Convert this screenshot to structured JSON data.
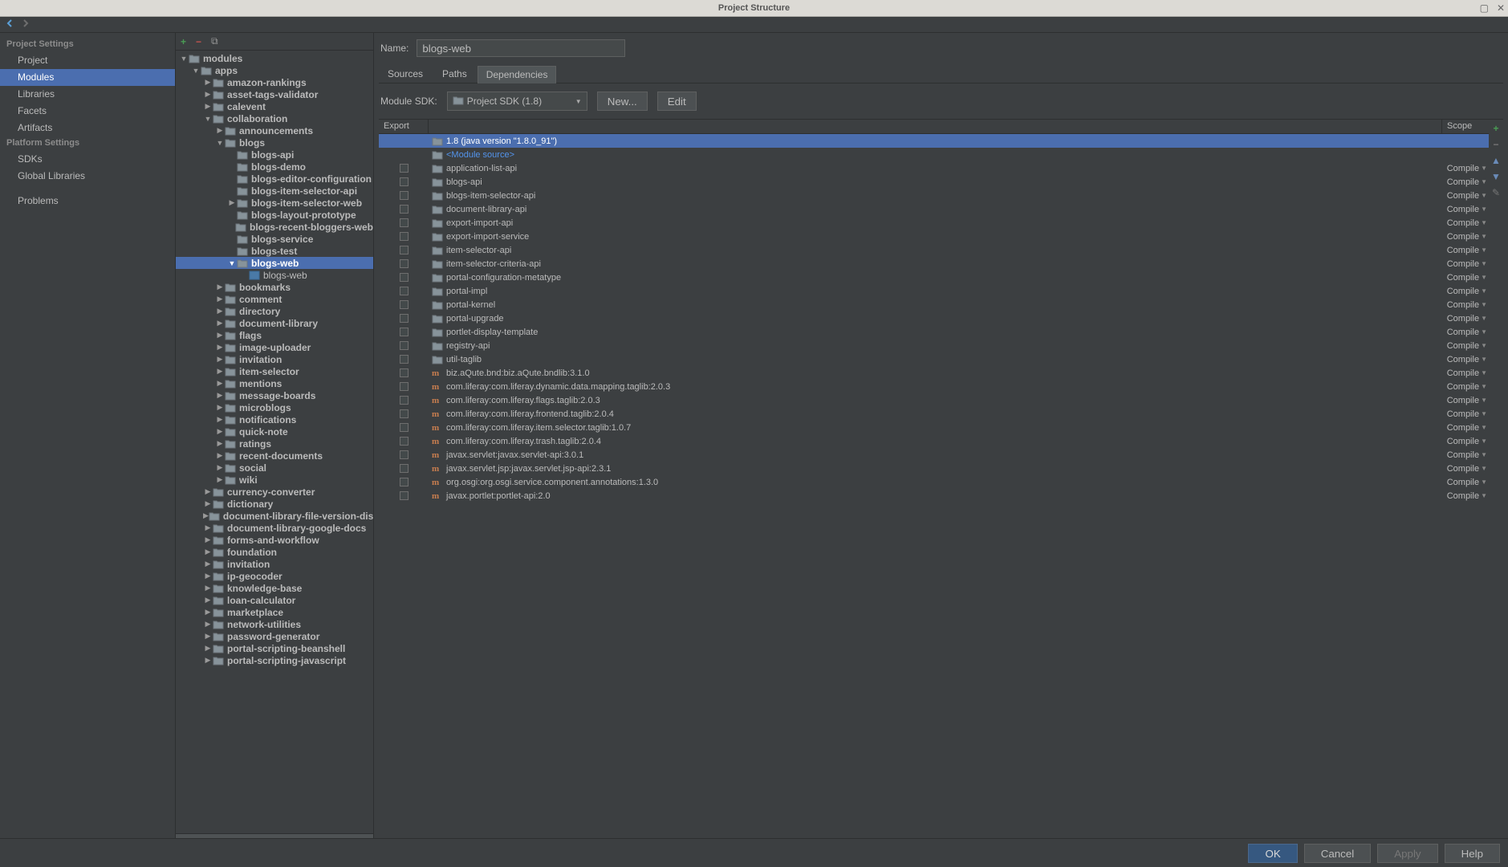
{
  "window_title": "Project Structure",
  "sidebar": {
    "section1": "Project Settings",
    "items1": [
      "Project",
      "Modules",
      "Libraries",
      "Facets",
      "Artifacts"
    ],
    "section2": "Platform Settings",
    "items2": [
      "SDKs",
      "Global Libraries"
    ],
    "problems": "Problems"
  },
  "tree": [
    {
      "d": 0,
      "arrow": "down",
      "icon": "root",
      "label": "modules"
    },
    {
      "d": 1,
      "arrow": "down",
      "icon": "folder",
      "label": "apps"
    },
    {
      "d": 2,
      "arrow": "right",
      "icon": "folder",
      "label": "amazon-rankings"
    },
    {
      "d": 2,
      "arrow": "right",
      "icon": "folder",
      "label": "asset-tags-validator"
    },
    {
      "d": 2,
      "arrow": "right",
      "icon": "folder",
      "label": "calevent"
    },
    {
      "d": 2,
      "arrow": "down",
      "icon": "folder",
      "label": "collaboration"
    },
    {
      "d": 3,
      "arrow": "right",
      "icon": "folder",
      "label": "announcements"
    },
    {
      "d": 3,
      "arrow": "down",
      "icon": "folder",
      "label": "blogs"
    },
    {
      "d": 4,
      "arrow": "",
      "icon": "folder",
      "label": "blogs-api"
    },
    {
      "d": 4,
      "arrow": "",
      "icon": "folder",
      "label": "blogs-demo"
    },
    {
      "d": 4,
      "arrow": "",
      "icon": "folder",
      "label": "blogs-editor-configuration"
    },
    {
      "d": 4,
      "arrow": "",
      "icon": "folder",
      "label": "blogs-item-selector-api"
    },
    {
      "d": 4,
      "arrow": "right",
      "icon": "folder",
      "label": "blogs-item-selector-web"
    },
    {
      "d": 4,
      "arrow": "",
      "icon": "folder",
      "label": "blogs-layout-prototype"
    },
    {
      "d": 4,
      "arrow": "",
      "icon": "folder",
      "label": "blogs-recent-bloggers-web"
    },
    {
      "d": 4,
      "arrow": "",
      "icon": "folder",
      "label": "blogs-service"
    },
    {
      "d": 4,
      "arrow": "",
      "icon": "folder",
      "label": "blogs-test"
    },
    {
      "d": 4,
      "arrow": "down",
      "icon": "folder",
      "label": "blogs-web",
      "sel": true
    },
    {
      "d": 5,
      "arrow": "",
      "icon": "mod",
      "label": "blogs-web",
      "norm": true
    },
    {
      "d": 3,
      "arrow": "right",
      "icon": "folder",
      "label": "bookmarks"
    },
    {
      "d": 3,
      "arrow": "right",
      "icon": "folder",
      "label": "comment"
    },
    {
      "d": 3,
      "arrow": "right",
      "icon": "folder",
      "label": "directory"
    },
    {
      "d": 3,
      "arrow": "right",
      "icon": "folder",
      "label": "document-library"
    },
    {
      "d": 3,
      "arrow": "right",
      "icon": "folder",
      "label": "flags"
    },
    {
      "d": 3,
      "arrow": "right",
      "icon": "folder",
      "label": "image-uploader"
    },
    {
      "d": 3,
      "arrow": "right",
      "icon": "folder",
      "label": "invitation"
    },
    {
      "d": 3,
      "arrow": "right",
      "icon": "folder",
      "label": "item-selector"
    },
    {
      "d": 3,
      "arrow": "right",
      "icon": "folder",
      "label": "mentions"
    },
    {
      "d": 3,
      "arrow": "right",
      "icon": "folder",
      "label": "message-boards"
    },
    {
      "d": 3,
      "arrow": "right",
      "icon": "folder",
      "label": "microblogs"
    },
    {
      "d": 3,
      "arrow": "right",
      "icon": "folder",
      "label": "notifications"
    },
    {
      "d": 3,
      "arrow": "right",
      "icon": "folder",
      "label": "quick-note"
    },
    {
      "d": 3,
      "arrow": "right",
      "icon": "folder",
      "label": "ratings"
    },
    {
      "d": 3,
      "arrow": "right",
      "icon": "folder",
      "label": "recent-documents"
    },
    {
      "d": 3,
      "arrow": "right",
      "icon": "folder",
      "label": "social"
    },
    {
      "d": 3,
      "arrow": "right",
      "icon": "folder",
      "label": "wiki"
    },
    {
      "d": 2,
      "arrow": "right",
      "icon": "folder",
      "label": "currency-converter"
    },
    {
      "d": 2,
      "arrow": "right",
      "icon": "folder",
      "label": "dictionary"
    },
    {
      "d": 2,
      "arrow": "right",
      "icon": "folder",
      "label": "document-library-file-version-discu"
    },
    {
      "d": 2,
      "arrow": "right",
      "icon": "folder",
      "label": "document-library-google-docs"
    },
    {
      "d": 2,
      "arrow": "right",
      "icon": "folder",
      "label": "forms-and-workflow"
    },
    {
      "d": 2,
      "arrow": "right",
      "icon": "folder",
      "label": "foundation"
    },
    {
      "d": 2,
      "arrow": "right",
      "icon": "folder",
      "label": "invitation"
    },
    {
      "d": 2,
      "arrow": "right",
      "icon": "folder",
      "label": "ip-geocoder"
    },
    {
      "d": 2,
      "arrow": "right",
      "icon": "folder",
      "label": "knowledge-base"
    },
    {
      "d": 2,
      "arrow": "right",
      "icon": "folder",
      "label": "loan-calculator"
    },
    {
      "d": 2,
      "arrow": "right",
      "icon": "folder",
      "label": "marketplace"
    },
    {
      "d": 2,
      "arrow": "right",
      "icon": "folder",
      "label": "network-utilities"
    },
    {
      "d": 2,
      "arrow": "right",
      "icon": "folder",
      "label": "password-generator"
    },
    {
      "d": 2,
      "arrow": "right",
      "icon": "folder",
      "label": "portal-scripting-beanshell"
    },
    {
      "d": 2,
      "arrow": "right",
      "icon": "folder",
      "label": "portal-scripting-javascript"
    }
  ],
  "detail": {
    "name_label": "Name:",
    "name_value": "blogs-web",
    "tabs": [
      "Sources",
      "Paths",
      "Dependencies"
    ],
    "active_tab": 2,
    "sdk_label": "Module SDK:",
    "sdk_value": "Project SDK (1.8)",
    "btn_new": "New...",
    "btn_edit": "Edit",
    "header_export": "Export",
    "header_scope": "Scope",
    "deps": [
      {
        "icon": "sdk",
        "name": "1.8 (java version \"1.8.0_91\")",
        "scope": "",
        "cb": false,
        "sel": true,
        "indent": 1
      },
      {
        "icon": "src",
        "name": "<Module source>",
        "scope": "",
        "cb": false,
        "indent": 1,
        "link": true
      },
      {
        "icon": "mod",
        "name": "application-list-api",
        "scope": "Compile",
        "cb": true
      },
      {
        "icon": "mod",
        "name": "blogs-api",
        "scope": "Compile",
        "cb": true
      },
      {
        "icon": "mod",
        "name": "blogs-item-selector-api",
        "scope": "Compile",
        "cb": true
      },
      {
        "icon": "mod",
        "name": "document-library-api",
        "scope": "Compile",
        "cb": true
      },
      {
        "icon": "mod",
        "name": "export-import-api",
        "scope": "Compile",
        "cb": true
      },
      {
        "icon": "mod",
        "name": "export-import-service",
        "scope": "Compile",
        "cb": true
      },
      {
        "icon": "mod",
        "name": "item-selector-api",
        "scope": "Compile",
        "cb": true
      },
      {
        "icon": "mod",
        "name": "item-selector-criteria-api",
        "scope": "Compile",
        "cb": true
      },
      {
        "icon": "mod",
        "name": "portal-configuration-metatype",
        "scope": "Compile",
        "cb": true
      },
      {
        "icon": "mod",
        "name": "portal-impl",
        "scope": "Compile",
        "cb": true
      },
      {
        "icon": "mod",
        "name": "portal-kernel",
        "scope": "Compile",
        "cb": true
      },
      {
        "icon": "mod",
        "name": "portal-upgrade",
        "scope": "Compile",
        "cb": true
      },
      {
        "icon": "mod",
        "name": "portlet-display-template",
        "scope": "Compile",
        "cb": true
      },
      {
        "icon": "mod",
        "name": "registry-api",
        "scope": "Compile",
        "cb": true
      },
      {
        "icon": "mod",
        "name": "util-taglib",
        "scope": "Compile",
        "cb": true
      },
      {
        "icon": "lib",
        "name": "biz.aQute.bnd:biz.aQute.bndlib:3.1.0",
        "scope": "Compile",
        "cb": true
      },
      {
        "icon": "lib",
        "name": "com.liferay:com.liferay.dynamic.data.mapping.taglib:2.0.3",
        "scope": "Compile",
        "cb": true
      },
      {
        "icon": "lib",
        "name": "com.liferay:com.liferay.flags.taglib:2.0.3",
        "scope": "Compile",
        "cb": true
      },
      {
        "icon": "lib",
        "name": "com.liferay:com.liferay.frontend.taglib:2.0.4",
        "scope": "Compile",
        "cb": true
      },
      {
        "icon": "lib",
        "name": "com.liferay:com.liferay.item.selector.taglib:1.0.7",
        "scope": "Compile",
        "cb": true
      },
      {
        "icon": "lib",
        "name": "com.liferay:com.liferay.trash.taglib:2.0.4",
        "scope": "Compile",
        "cb": true
      },
      {
        "icon": "lib",
        "name": "javax.servlet:javax.servlet-api:3.0.1",
        "scope": "Compile",
        "cb": true
      },
      {
        "icon": "lib",
        "name": "javax.servlet.jsp:javax.servlet.jsp-api:2.3.1",
        "scope": "Compile",
        "cb": true
      },
      {
        "icon": "lib",
        "name": "org.osgi:org.osgi.service.component.annotations:1.3.0",
        "scope": "Compile",
        "cb": true
      },
      {
        "icon": "lib",
        "name": "javax.portlet:portlet-api:2.0",
        "scope": "Compile",
        "cb": true
      }
    ]
  },
  "footer": {
    "ok": "OK",
    "cancel": "Cancel",
    "apply": "Apply",
    "help": "Help"
  }
}
